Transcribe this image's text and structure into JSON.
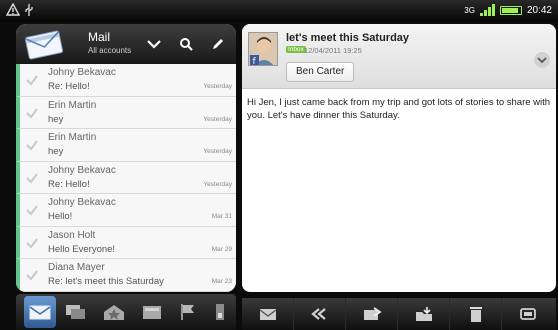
{
  "status_bar": {
    "network": "3G",
    "time": "20:42"
  },
  "mailbox": {
    "title": "Mail",
    "account": "All accounts"
  },
  "messages": [
    {
      "from": "Johny Bekavac",
      "subject": "Re: Hello!",
      "date": "Yesterday"
    },
    {
      "from": "Erin Martin",
      "subject": "hey",
      "date": "Yesterday"
    },
    {
      "from": "Erin Martin",
      "subject": "hey",
      "date": "Yesterday"
    },
    {
      "from": "Johny Bekavac",
      "subject": "Re: Hello!",
      "date": "Yesterday"
    },
    {
      "from": "Johny Bekavac",
      "subject": "Hello!",
      "date": "Mar 31"
    },
    {
      "from": "Jason Holt",
      "subject": "Hello Everyone!",
      "date": "Mar 29"
    },
    {
      "from": "Diana Mayer",
      "subject": "Re: let's meet this Saturday",
      "date": "Mar 23"
    }
  ],
  "reader": {
    "subject": "let's meet this Saturday",
    "folder_badge": "Inbox",
    "date": "12/04/2011 19:25",
    "sender": "Ben Carter",
    "body": "Hi Jen, I just came back from my trip and got lots of stories to share with you. Let's have dinner this Saturday."
  },
  "icons": {
    "header": [
      "mail-envelope-icon",
      "chevron-down-icon",
      "search-icon",
      "compose-icon"
    ],
    "tabs": [
      "inbox-icon",
      "conversations-icon",
      "group-icon",
      "unread-icon",
      "flag-icon",
      "attachment-icon"
    ],
    "actions": [
      "reply-icon",
      "reply-all-icon",
      "forward-icon",
      "move-folder-icon",
      "delete-icon",
      "more-icon"
    ]
  },
  "colors": {
    "accent": "#63c58c",
    "badge": "#7bc043",
    "signal": "#9ff056",
    "active_tab": "#4a7bb8"
  }
}
